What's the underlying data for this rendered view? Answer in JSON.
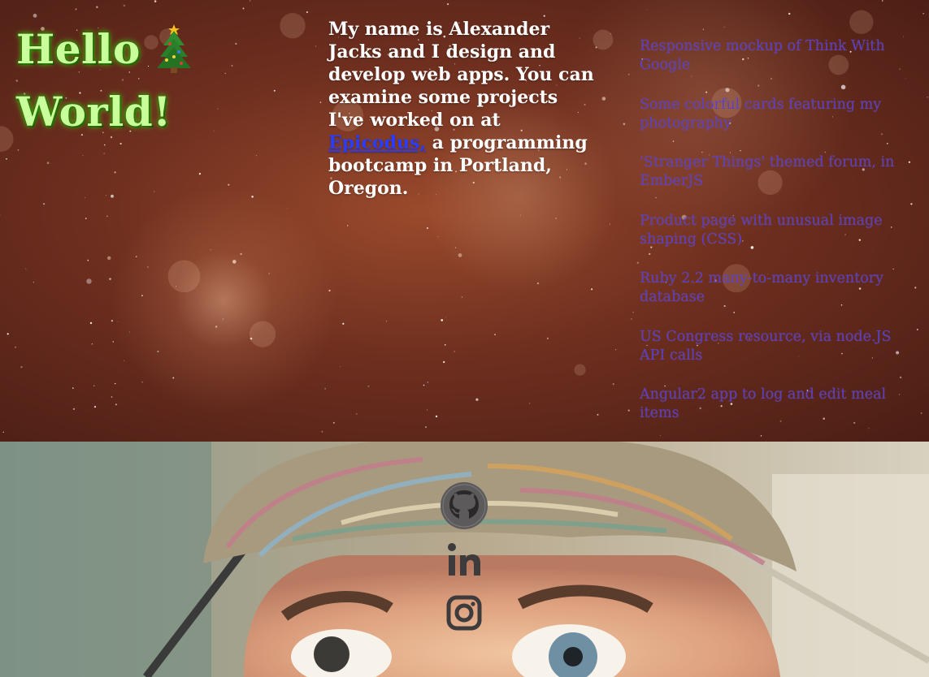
{
  "hero": {
    "greeting_line1": "Hello",
    "greeting_line2": "World!",
    "greeting_emoji_icon": "christmas-tree-icon",
    "bio_before_link": "My name is Alexander Jacks and I design and develop web apps. You can examine some projects I've worked on at ",
    "bio_link": "Epicodus,",
    "bio_after_link": " a programming bootcamp in Portland, Oregon.",
    "colors": {
      "greeting_text": "#c9ff9a",
      "greeting_glow": "#2b8a00",
      "bio_text": "#ffffff",
      "link": "#2a3cff",
      "project_links": "#5a3fc4"
    }
  },
  "projects": [
    "Responsive mockup of Think With Google",
    "Some colorful cards featuring my photography",
    "'Stranger Things' themed forum, in EmberJS",
    "Product page with unusual image shaping (CSS)",
    "Ruby 2.2 many-to-many inventory database",
    "US Congress resource, via node.JS API calls",
    "Angular2 app to log and edit meal items"
  ],
  "social": [
    {
      "name": "github",
      "icon": "github-icon"
    },
    {
      "name": "linkedin",
      "icon": "linkedin-icon"
    },
    {
      "name": "instagram",
      "icon": "instagram-icon"
    }
  ]
}
